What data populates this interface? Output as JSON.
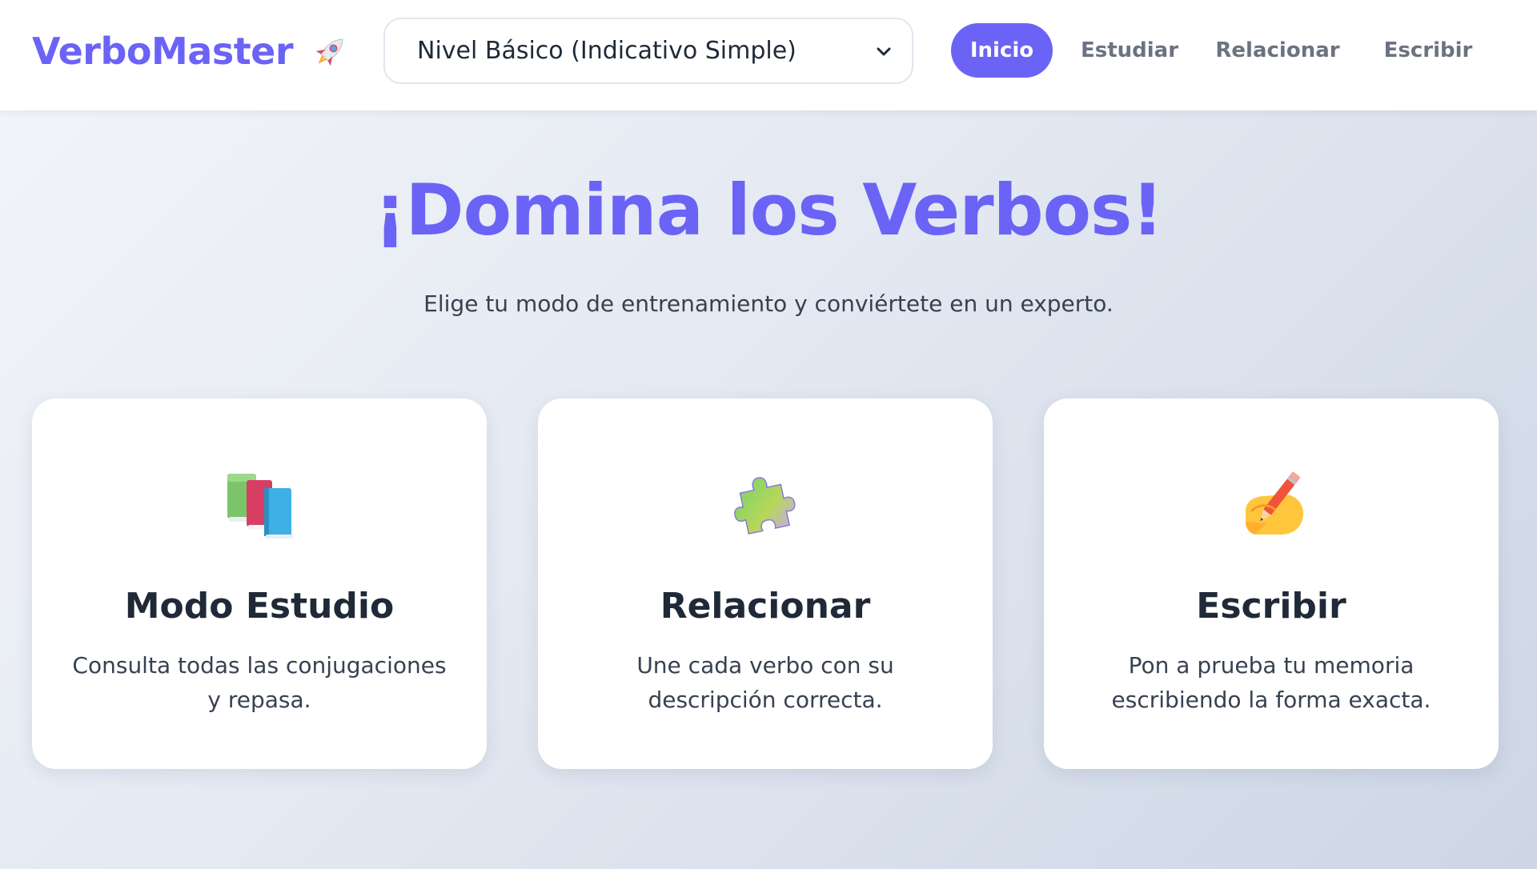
{
  "header": {
    "logo_text": "VerboMaster",
    "logo_icon": "rocket-icon",
    "level_select": {
      "value": "Nivel Básico (Indicativo Simple)"
    },
    "nav": {
      "inicio": "Inicio",
      "estudiar": "Estudiar",
      "relacionar": "Relacionar",
      "escribir": "Escribir"
    },
    "active_tab": "inicio"
  },
  "hero": {
    "title": "¡Domina los Verbos!",
    "subtitle": "Elige tu modo de entrenamiento y conviértete en un experto."
  },
  "cards": [
    {
      "icon": "books-icon",
      "title": "Modo Estudio",
      "description": "Consulta todas las conjugaciones y repasa."
    },
    {
      "icon": "puzzle-icon",
      "title": "Relacionar",
      "description": "Une cada verbo con su descripción correcta."
    },
    {
      "icon": "writing-hand-icon",
      "title": "Escribir",
      "description": "Pon a prueba tu memoria escribiendo la forma exacta."
    }
  ],
  "colors": {
    "accent": "#6b63f6",
    "text_dark": "#1f2937",
    "text_muted": "#6b7280"
  }
}
